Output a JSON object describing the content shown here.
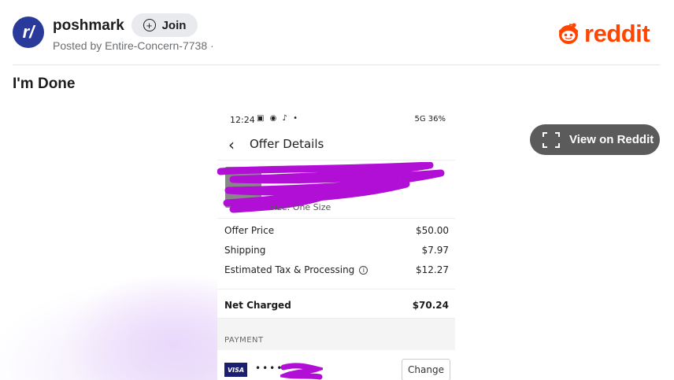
{
  "header": {
    "subreddit_avatar_text": "r/",
    "subreddit": "poshmark",
    "join_label": "Join",
    "posted_by": "Posted by Entire-Concern-7738 ·",
    "brand": "reddit",
    "brand_color": "#ff4500"
  },
  "post": {
    "title": "I'm Done"
  },
  "media": {
    "view_button_label": "View on Reddit"
  },
  "phone": {
    "status_time": "12:24",
    "status_right": "5G 36%",
    "screen_title": "Offer Details",
    "item_size": "Size: One Size",
    "prices": [
      {
        "label": "Offer Price",
        "value": "$50.00"
      },
      {
        "label": "Shipping",
        "value": "$7.97"
      },
      {
        "label": "Estimated Tax & Processing",
        "value": "$12.27"
      }
    ],
    "net_label": "Net Charged",
    "net_value": "$70.24",
    "payment_label": "PAYMENT",
    "card_brand": "VISA",
    "card_dots": "••••",
    "change_label": "Change",
    "redaction_color": "#b10fd6",
    "visa_color": "#1a1f71"
  }
}
